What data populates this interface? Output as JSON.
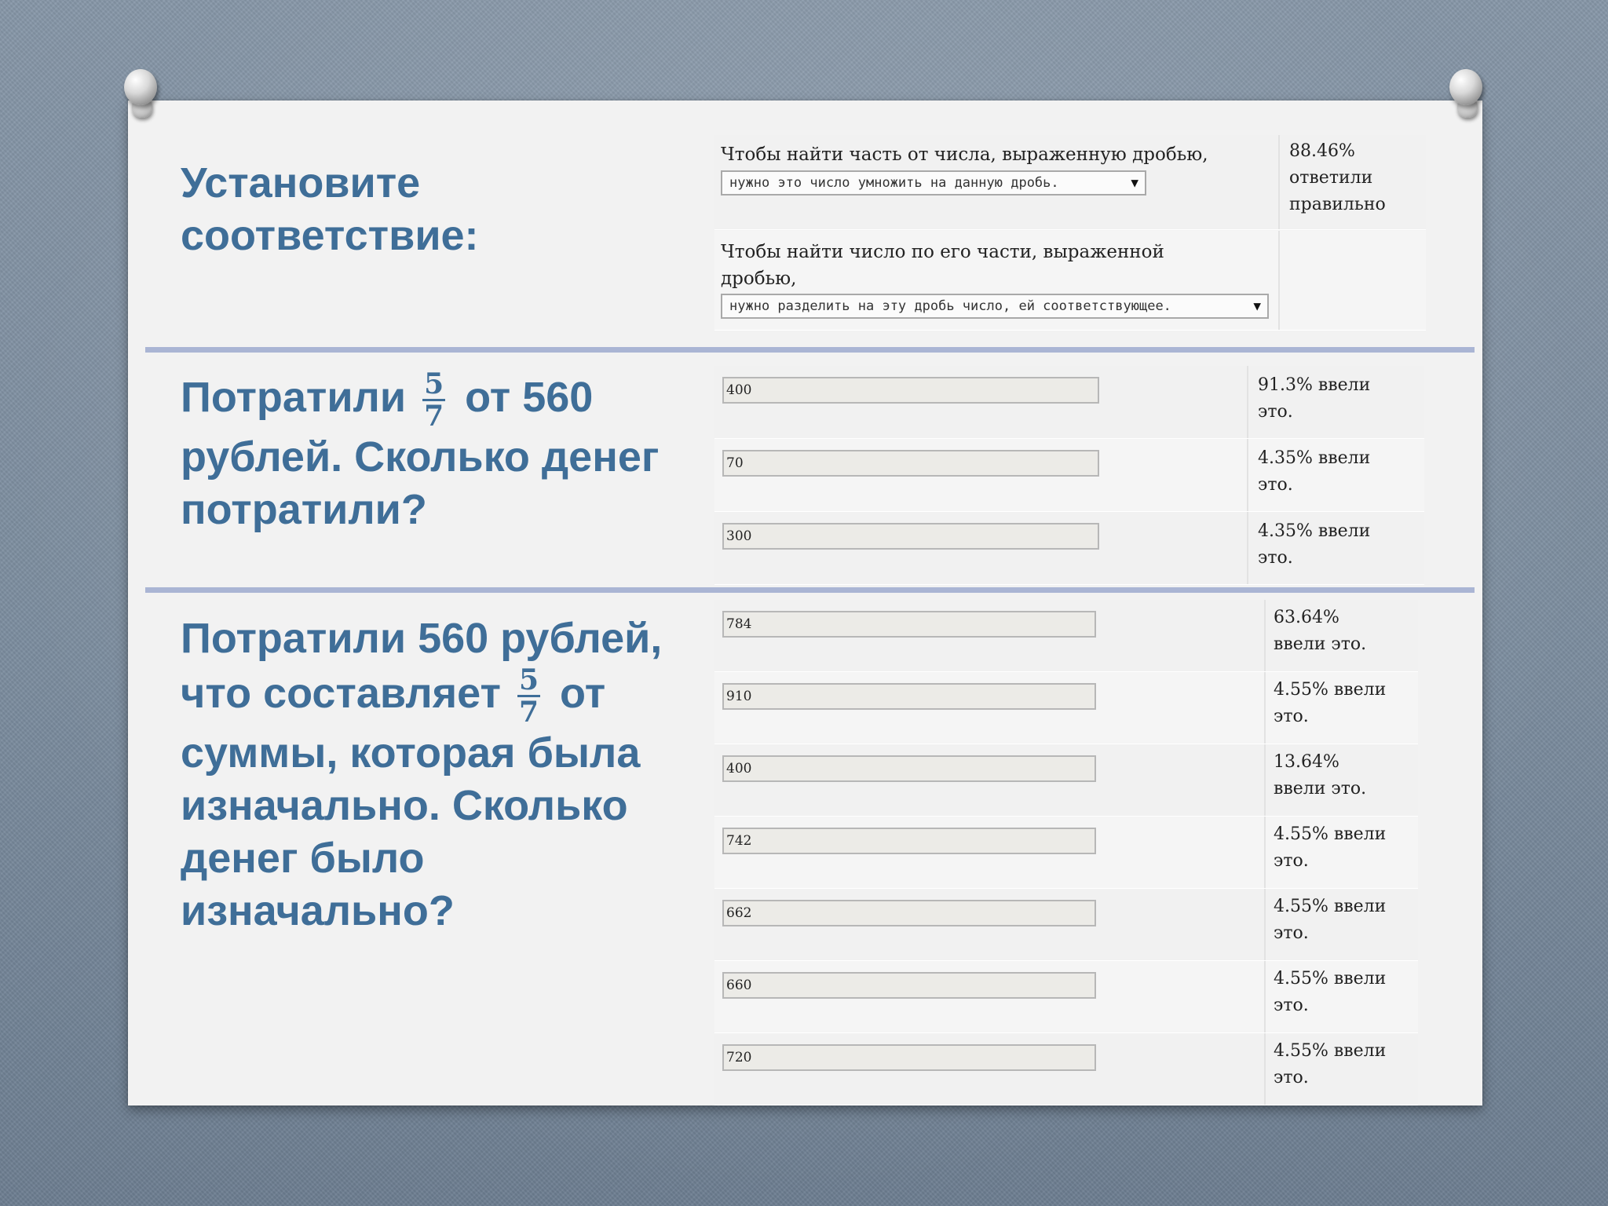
{
  "section1": {
    "title_line1": "Установите",
    "title_line2": "соответствие:",
    "rows": [
      {
        "prompt": "Чтобы найти часть от числа, выраженную дробью,",
        "prompt2": "",
        "selected": "нужно это число умножить на данную дробь.",
        "stat": "88.46%\nответили\nправильно"
      },
      {
        "prompt": "Чтобы найти число по его части, выраженной",
        "prompt2": "дробью,",
        "selected": "нужно разделить на эту дробь число, ей соответствующее.",
        "stat": ""
      }
    ]
  },
  "section2": {
    "line1_before": "Потратили",
    "fraction_num": "5",
    "fraction_den": "7",
    "line1_after": "от 560",
    "line2": "рублей. Сколько денег",
    "line3": "потратили?",
    "answers": [
      {
        "value": "400",
        "stat": "91.3% ввели\nэто."
      },
      {
        "value": "70",
        "stat": "4.35% ввели\nэто."
      },
      {
        "value": "300",
        "stat": "4.35% ввели\nэто."
      }
    ]
  },
  "section3": {
    "line1": "Потратили 560 рублей,",
    "line2_before": "что составляет",
    "fraction_num": "5",
    "fraction_den": "7",
    "line2_after": "от",
    "line3": "суммы, которая была",
    "line4": "изначально. Сколько",
    "line5": "денег было",
    "line6": "изначально?",
    "answers": [
      {
        "value": "784",
        "stat": "63.64%\nввели это."
      },
      {
        "value": "910",
        "stat": "4.55% ввели\nэто."
      },
      {
        "value": "400",
        "stat": "13.64%\nввели это."
      },
      {
        "value": "742",
        "stat": "4.55% ввели\nэто."
      },
      {
        "value": "662",
        "stat": "4.55% ввели\nэто."
      },
      {
        "value": "660",
        "stat": "4.55% ввели\nэто."
      },
      {
        "value": "720",
        "stat": "4.55% ввели\nэто."
      }
    ]
  },
  "icons": {
    "pin_left": "pushpin-icon",
    "pin_right": "pushpin-icon",
    "dropdown_arrow": "▼"
  }
}
